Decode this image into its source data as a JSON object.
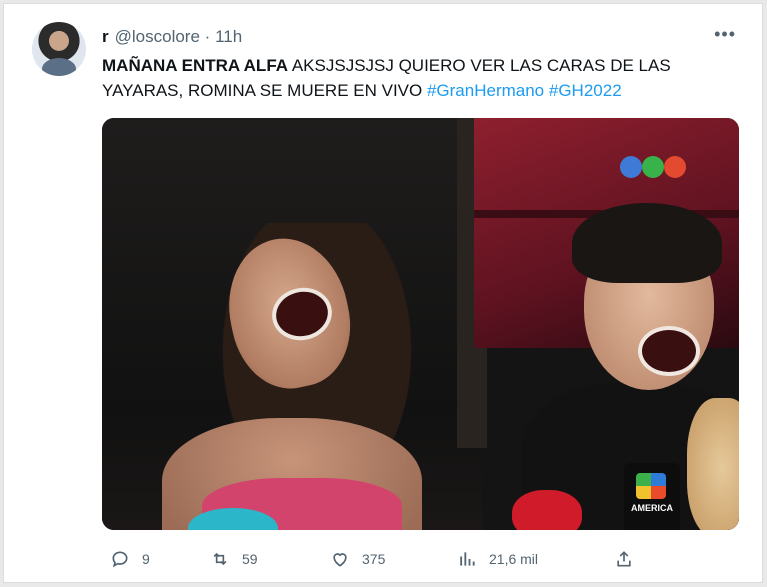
{
  "tweet": {
    "display_name": "r",
    "handle": "@loscolore",
    "separator": "·",
    "time": "11h",
    "more_icon": "more-horizontal-icon",
    "text_bold": "MAÑANA ENTRA ALFA",
    "text_body": " AKSJSJSJSJ QUIERO VER LAS CARAS DE LAS YAYARAS, ROMINA SE MUERE EN VIVO ",
    "hashtag_1": "#GranHermano",
    "hashtag_2": "#GH2022",
    "hashtag_color": "#1d9bf0",
    "media": {
      "mic_label": "AMERICA"
    },
    "actions": {
      "replies": "9",
      "retweets": "59",
      "likes": "375",
      "views": "21,6 mil"
    }
  }
}
